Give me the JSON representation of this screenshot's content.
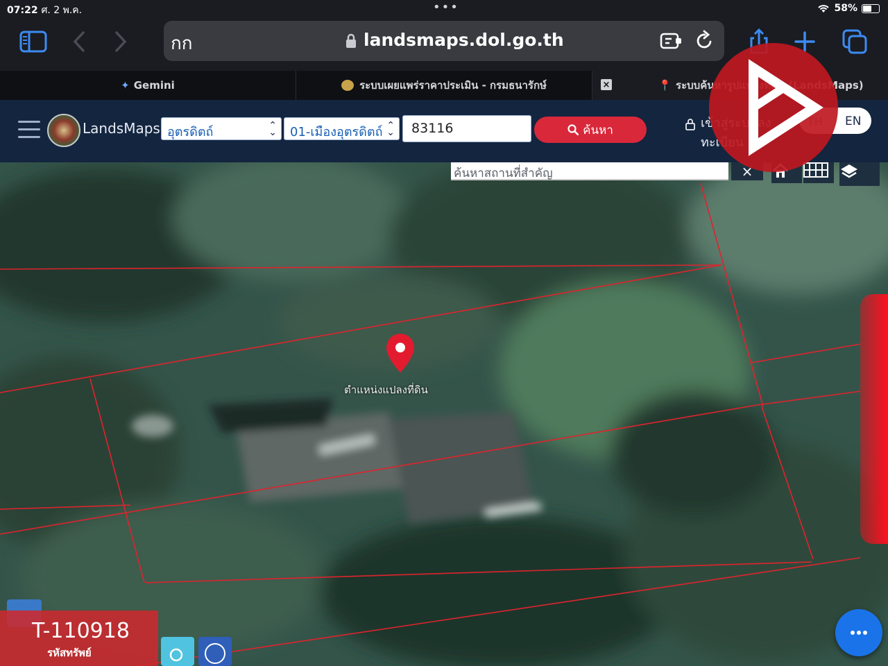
{
  "status_bar": {
    "time": "07:22",
    "date": "ศ. 2 พ.ค.",
    "battery_percent": "58%",
    "battery_level": 0.58
  },
  "browser": {
    "text_size_label": "กก",
    "url": "landsmaps.dol.go.th",
    "tabs": [
      {
        "label": "Gemini"
      },
      {
        "label": "ระบบเผยแพร่ราคาประเมิน - กรมธนารักษ์"
      },
      {
        "label": "ระบบค้นหารูปแปลงที่ดิน (LandsMaps)"
      }
    ]
  },
  "header": {
    "site_name": "LandsMaps",
    "province_select": "อุตรดิตถ์",
    "district_select": "01-เมืองอุตรดิตถ์",
    "parcel_number": "83116",
    "search_label": "ค้นหา",
    "login_label": "เข้าสู่ระบบลงทะเบียน",
    "lang_th": "TH",
    "lang_en": "EN"
  },
  "map": {
    "place_search_placeholder": "ค้นหาสถานที่สำคัญ",
    "clear_symbol": "×",
    "marker_label": "ตำแหน่งแปลงที่ดิน",
    "parcel_line_color": "#e0232d"
  },
  "asset": {
    "code": "T-110918",
    "label": "รหัสทรัพย์"
  },
  "colors": {
    "header_bg": "#14253f",
    "search_button": "#d9283a",
    "fab": "#1a73e8",
    "watermark": "#be1820"
  }
}
